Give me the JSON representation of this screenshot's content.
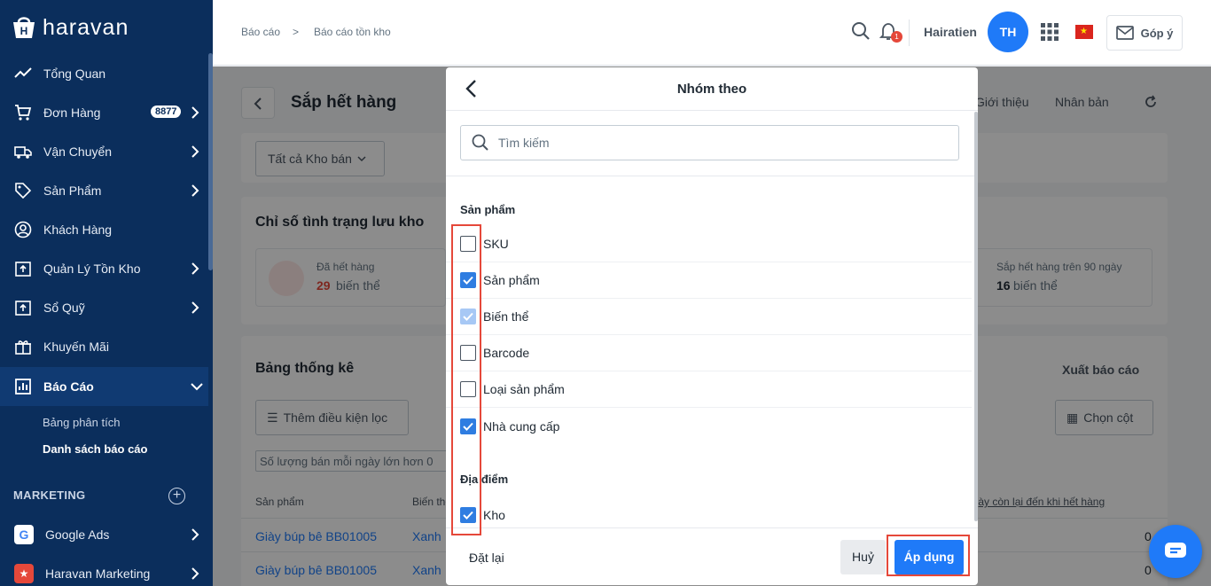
{
  "sidebar": {
    "brand": "haravan",
    "items": [
      {
        "label": "Tổng Quan"
      },
      {
        "label": "Đơn Hàng",
        "badge": "8877"
      },
      {
        "label": "Vận Chuyển"
      },
      {
        "label": "Sản Phẩm"
      },
      {
        "label": "Khách Hàng"
      },
      {
        "label": "Quản Lý Tồn Kho"
      },
      {
        "label": "Sổ Quỹ"
      },
      {
        "label": "Khuyến Mãi"
      },
      {
        "label": "Báo Cáo"
      }
    ],
    "sub_items": [
      {
        "label": "Bảng phân tích"
      },
      {
        "label": "Danh sách báo cáo"
      }
    ],
    "section_marketing": "MARKETING",
    "marketing_items": [
      {
        "label": "Google Ads"
      },
      {
        "label": "Haravan Marketing"
      }
    ]
  },
  "topbar": {
    "breadcrumb": [
      "Báo cáo",
      "Báo cáo tồn kho"
    ],
    "separator": ">",
    "notification_count": "1",
    "username": "Hairatien",
    "avatar_initials": "TH",
    "feedback_label": "Góp ý"
  },
  "page": {
    "title": "Sắp hết hàng",
    "intro_label": "Giới thiệu",
    "duplicate_label": "Nhân bản",
    "warehouse_filter": "Tất cả Kho bán",
    "status_card_title": "Chỉ số tình trạng lưu kho",
    "stat_left_label": "Đã hết hàng",
    "stat_left_value": "29",
    "stat_left_unit": "biến thể",
    "stat_right_label": "Sắp hết hàng trên 90 ngày",
    "stat_right_value": "16",
    "stat_right_unit": "biến thể",
    "table_title": "Bảng thống kê",
    "export_label": "Xuất báo cáo",
    "add_filter_label": "Thêm điều kiện lọc",
    "choose_columns_label": "Chọn cột",
    "filter_chip": "Số lượng bán mỗi ngày lớn hơn 0",
    "columns": [
      "Sản phẩm",
      "Biến thể",
      "Số ngày còn lại đến khi hết hàng"
    ],
    "rows": [
      {
        "product": "Giày búp bê BB01005",
        "variant": "Xanh",
        "days": "0"
      },
      {
        "product": "Giày búp bê BB01005",
        "variant": "Xanh",
        "days": "0"
      }
    ]
  },
  "modal": {
    "title": "Nhóm theo",
    "search_placeholder": "Tìm kiếm",
    "group_product_title": "Sản phẩm",
    "product_options": [
      {
        "label": "SKU",
        "state": "unchecked"
      },
      {
        "label": "Sản phẩm",
        "state": "checked"
      },
      {
        "label": "Biến thể",
        "state": "disabled-checked"
      },
      {
        "label": "Barcode",
        "state": "unchecked"
      },
      {
        "label": "Loại sản phẩm",
        "state": "unchecked"
      },
      {
        "label": "Nhà cung cấp",
        "state": "checked"
      }
    ],
    "group_location_title": "Địa điểm",
    "location_options": [
      {
        "label": "Kho",
        "state": "checked"
      }
    ],
    "reset_label": "Đặt lại",
    "cancel_label": "Huỷ",
    "apply_label": "Áp dụng"
  },
  "colors": {
    "sidebar_bg": "#0b2e5c",
    "accent": "#1f7af8",
    "checkbox_checked": "#2f7de1",
    "highlight": "#e5483a"
  }
}
